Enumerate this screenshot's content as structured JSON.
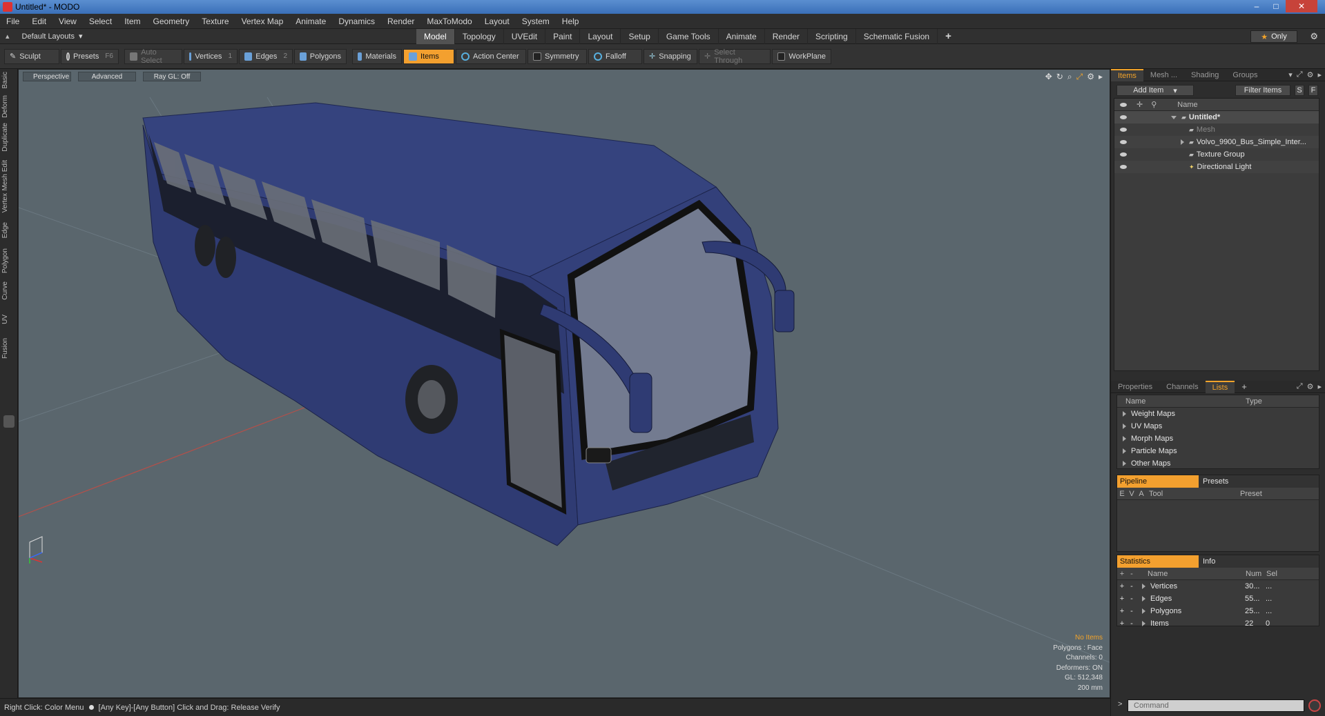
{
  "window": {
    "title": "Untitled* - MODO",
    "minimize": "–",
    "maximize": "□",
    "close": "✕"
  },
  "menu": [
    "File",
    "Edit",
    "View",
    "Select",
    "Item",
    "Geometry",
    "Texture",
    "Vertex Map",
    "Animate",
    "Dynamics",
    "Render",
    "MaxToModo",
    "Layout",
    "System",
    "Help"
  ],
  "layoutbar": {
    "layout_label": "Default Layouts",
    "tabs": [
      {
        "label": "Model",
        "active": true
      },
      {
        "label": "Topology",
        "active": false
      },
      {
        "label": "UVEdit",
        "active": false
      },
      {
        "label": "Paint",
        "active": false
      },
      {
        "label": "Layout",
        "active": false
      },
      {
        "label": "Setup",
        "active": false
      },
      {
        "label": "Game Tools",
        "active": false
      },
      {
        "label": "Animate",
        "active": false
      },
      {
        "label": "Render",
        "active": false
      },
      {
        "label": "Scripting",
        "active": false
      },
      {
        "label": "Schematic Fusion",
        "active": false
      }
    ],
    "plus": "+",
    "only_label": "Only",
    "gear": "⚙"
  },
  "toolbar": {
    "sculpt": "Sculpt",
    "presets": "Presets",
    "presets_key": "F6",
    "auto_select": "Auto Select",
    "vertices": "Vertices",
    "vertices_key": "1",
    "edges": "Edges",
    "edges_key": "2",
    "polygons": "Polygons",
    "materials": "Materials",
    "items": "Items",
    "action_center": "Action Center",
    "symmetry": "Symmetry",
    "falloff": "Falloff",
    "snapping": "Snapping",
    "select_through": "Select Through",
    "workplane": "WorkPlane"
  },
  "left_tabs": [
    "Basic",
    "Deform",
    "Duplicate",
    "Mesh Edit",
    "Vertex",
    "Edge",
    "Polygon",
    "Curve",
    "UV",
    "Fusion"
  ],
  "viewport": {
    "view_mode": "Perspective",
    "shading": "Advanced",
    "raygl": "Ray GL: Off",
    "stats": {
      "selection": "No Items",
      "polygons": "Polygons : Face",
      "channels": "Channels: 0",
      "deformers": "Deformers: ON",
      "gl": "GL: 512,348",
      "scale": "200 mm"
    }
  },
  "statusbar": {
    "left": "Right Click: Color Menu",
    "right": "[Any Key]-[Any Button] Click and Drag: Release Verify"
  },
  "items_panel": {
    "tabs": [
      "Items",
      "Mesh ...",
      "Shading",
      "Groups"
    ],
    "add_item": "Add Item",
    "filter_items": "Filter Items",
    "s_btn": "S",
    "f_btn": "F",
    "col_name": "Name",
    "rows": [
      {
        "label": "Untitled*",
        "bold": true,
        "indent": 0
      },
      {
        "label": "Mesh",
        "dim": true,
        "indent": 1
      },
      {
        "label": "Volvo_9900_Bus_Simple_Inter...",
        "indent": 1
      },
      {
        "label": "Texture Group",
        "indent": 1
      },
      {
        "label": "Directional Light",
        "indent": 1
      }
    ]
  },
  "lists_panel": {
    "tabs": [
      "Properties",
      "Channels",
      "Lists"
    ],
    "col_name": "Name",
    "col_type": "Type",
    "rows": [
      "Weight Maps",
      "UV Maps",
      "Morph Maps",
      "Particle Maps",
      "Other Maps"
    ]
  },
  "pipeline_panel": {
    "tabs": [
      "Pipeline",
      "Presets"
    ],
    "cols": [
      "E",
      "V",
      "A",
      "Tool",
      "Preset"
    ]
  },
  "stats_panel": {
    "tabs": [
      "Statistics",
      "Info"
    ],
    "cols": [
      "+",
      "-",
      "Name",
      "Num",
      "Sel"
    ],
    "rows": [
      {
        "name": "Vertices",
        "num": "30...",
        "sel": "..."
      },
      {
        "name": "Edges",
        "num": "55...",
        "sel": "..."
      },
      {
        "name": "Polygons",
        "num": "25...",
        "sel": "..."
      },
      {
        "name": "Items",
        "num": "22",
        "sel": "0"
      }
    ]
  },
  "command": {
    "prompt": ">",
    "placeholder": "Command"
  },
  "colors": {
    "accent": "#f3a02f",
    "viewport_bg": "#5a666d",
    "bus_body": "#2f3d78"
  }
}
